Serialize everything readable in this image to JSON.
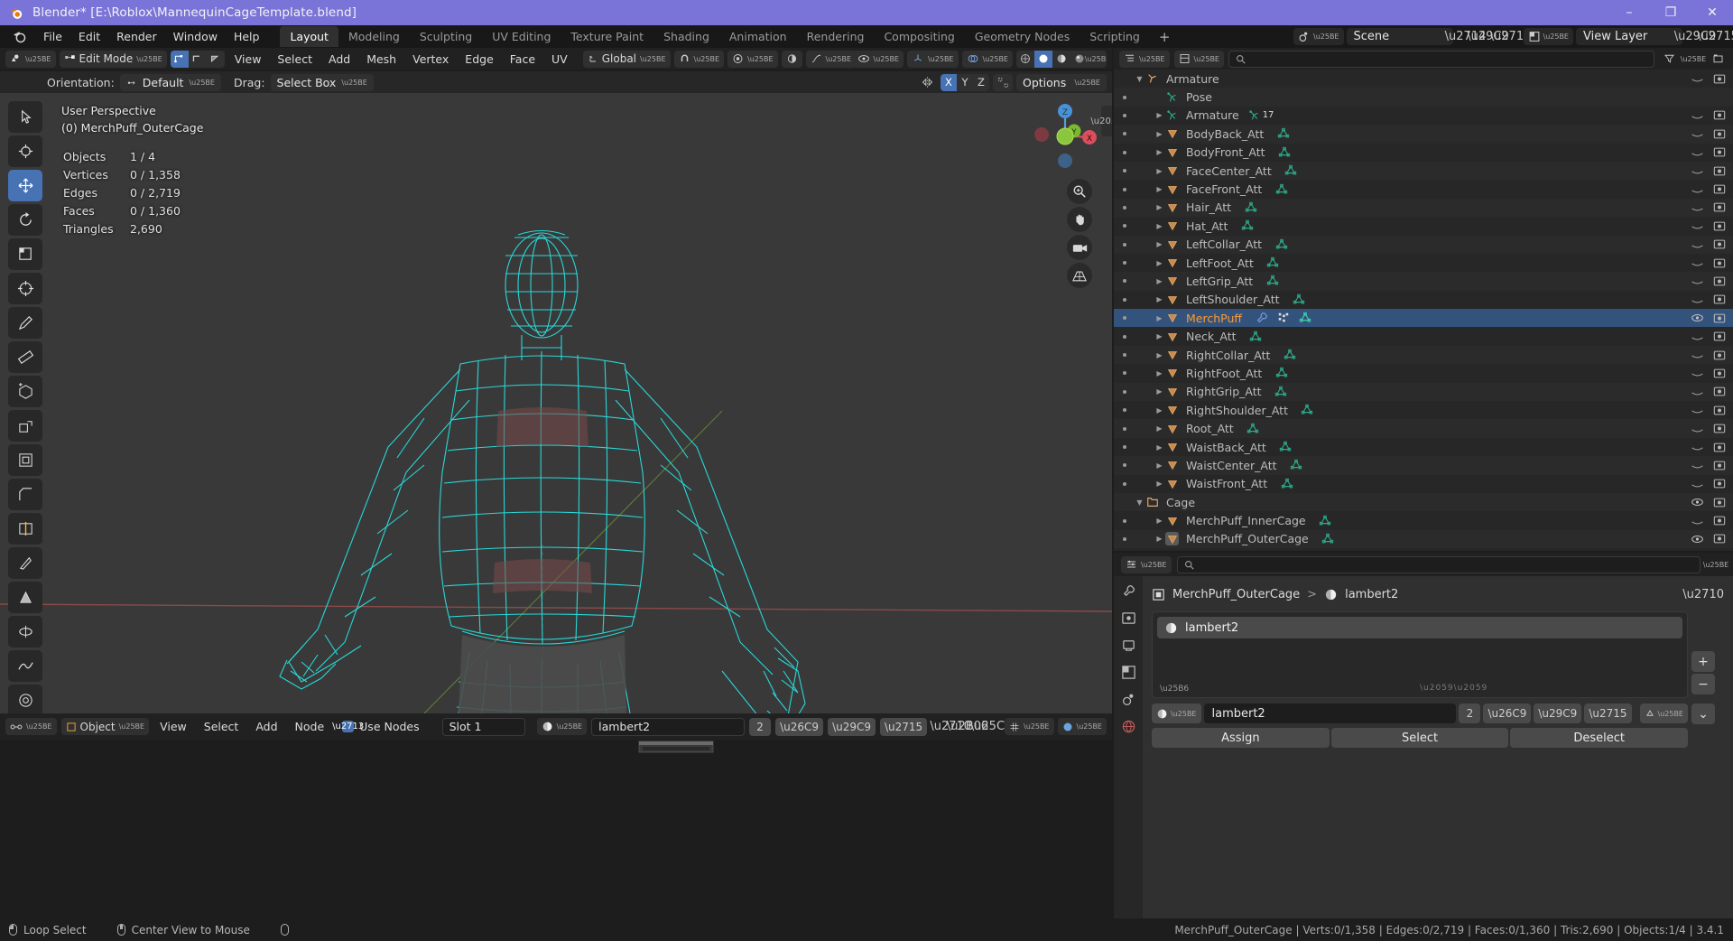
{
  "window": {
    "title": "Blender* [E:\\Roblox\\MannequinCageTemplate.blend]",
    "minimize": "–",
    "maximize": "❐",
    "close": "✕"
  },
  "topbar": {
    "menus": [
      "File",
      "Edit",
      "Render",
      "Window",
      "Help"
    ],
    "workspaces": [
      "Layout",
      "Modeling",
      "Sculpting",
      "UV Editing",
      "Texture Paint",
      "Shading",
      "Animation",
      "Rendering",
      "Compositing",
      "Geometry Nodes",
      "Scripting"
    ],
    "active_workspace": "Layout",
    "add_workspace": "+",
    "scene_name": "Scene",
    "view_layer_name": "View Layer"
  },
  "viewport_header": {
    "mode": "Edit Mode",
    "menus": [
      "View",
      "Select",
      "Add",
      "Mesh",
      "Vertex",
      "Edge",
      "Face",
      "UV"
    ],
    "transform_orientation": "Global"
  },
  "tool_settings": {
    "orientation_label": "Orientation:",
    "orientation_value": "Default",
    "drag_label": "Drag:",
    "drag_value": "Select Box",
    "axes": [
      "X",
      "Y",
      "Z"
    ],
    "active_axis": "X",
    "options_label": "Options"
  },
  "viewport": {
    "perspective": "User Perspective",
    "active_object": "(0) MerchPuff_OuterCage",
    "stats": [
      {
        "label": "Objects",
        "value": "1 / 4"
      },
      {
        "label": "Vertices",
        "value": "0 / 1,358"
      },
      {
        "label": "Edges",
        "value": "0 / 2,719"
      },
      {
        "label": "Faces",
        "value": "0 / 1,360"
      },
      {
        "label": "Triangles",
        "value": "2,690"
      }
    ],
    "gizmo_axes": {
      "x": "X",
      "y": "Y",
      "z": "Z"
    }
  },
  "node_editor": {
    "object_label": "Object",
    "menus": [
      "View",
      "Select",
      "Add",
      "Node"
    ],
    "use_nodes_label": "Use Nodes",
    "use_nodes_checked": true,
    "slot_label": "Slot 1",
    "material_name": "lambert2",
    "material_users": "2"
  },
  "outliner": {
    "search_placeholder": "",
    "rows": [
      {
        "name": "Armature",
        "indent": 0,
        "type": "armature-object",
        "expand": "down",
        "badge": ""
      },
      {
        "name": "Pose",
        "indent": 1,
        "type": "pose",
        "expand": ""
      },
      {
        "name": "Armature",
        "indent": 1,
        "type": "armature-data",
        "expand": "right",
        "badge": "17"
      },
      {
        "name": "BodyBack_Att",
        "indent": 1,
        "type": "mesh",
        "expand": "right"
      },
      {
        "name": "BodyFront_Att",
        "indent": 1,
        "type": "mesh",
        "expand": "right"
      },
      {
        "name": "FaceCenter_Att",
        "indent": 1,
        "type": "mesh",
        "expand": "right"
      },
      {
        "name": "FaceFront_Att",
        "indent": 1,
        "type": "mesh",
        "expand": "right"
      },
      {
        "name": "Hair_Att",
        "indent": 1,
        "type": "mesh",
        "expand": "right"
      },
      {
        "name": "Hat_Att",
        "indent": 1,
        "type": "mesh",
        "expand": "right"
      },
      {
        "name": "LeftCollar_Att",
        "indent": 1,
        "type": "mesh",
        "expand": "right"
      },
      {
        "name": "LeftFoot_Att",
        "indent": 1,
        "type": "mesh",
        "expand": "right"
      },
      {
        "name": "LeftGrip_Att",
        "indent": 1,
        "type": "mesh",
        "expand": "right"
      },
      {
        "name": "LeftShoulder_Att",
        "indent": 1,
        "type": "mesh",
        "expand": "right"
      },
      {
        "name": "MerchPuff",
        "indent": 1,
        "type": "mesh",
        "expand": "right",
        "selected": true
      },
      {
        "name": "Neck_Att",
        "indent": 1,
        "type": "mesh",
        "expand": "right"
      },
      {
        "name": "RightCollar_Att",
        "indent": 1,
        "type": "mesh",
        "expand": "right"
      },
      {
        "name": "RightFoot_Att",
        "indent": 1,
        "type": "mesh",
        "expand": "right"
      },
      {
        "name": "RightGrip_Att",
        "indent": 1,
        "type": "mesh",
        "expand": "right"
      },
      {
        "name": "RightShoulder_Att",
        "indent": 1,
        "type": "mesh",
        "expand": "right"
      },
      {
        "name": "Root_Att",
        "indent": 1,
        "type": "mesh",
        "expand": "right"
      },
      {
        "name": "WaistBack_Att",
        "indent": 1,
        "type": "mesh",
        "expand": "right"
      },
      {
        "name": "WaistCenter_Att",
        "indent": 1,
        "type": "mesh",
        "expand": "right"
      },
      {
        "name": "WaistFront_Att",
        "indent": 1,
        "type": "mesh",
        "expand": "right"
      },
      {
        "name": "Cage",
        "indent": 0,
        "type": "collection",
        "expand": "down"
      },
      {
        "name": "MerchPuff_InnerCage",
        "indent": 1,
        "type": "mesh",
        "expand": "right"
      },
      {
        "name": "MerchPuff_OuterCage",
        "indent": 1,
        "type": "mesh-active",
        "expand": "right"
      }
    ]
  },
  "properties": {
    "search_placeholder": "",
    "breadcrumb_object": "MerchPuff_OuterCage",
    "breadcrumb_sep": ">",
    "breadcrumb_material": "lambert2",
    "slot_material": "lambert2",
    "material_field_name": "lambert2",
    "material_users": "2",
    "buttons": {
      "assign": "Assign",
      "select": "Select",
      "deselect": "Deselect"
    },
    "add_slot": "+",
    "remove_slot": "−",
    "slot_menu": "⌄"
  },
  "statusbar": {
    "items": [
      {
        "mouse": "left",
        "label": "Loop Select"
      },
      {
        "mouse": "middle",
        "label": "Center View to Mouse"
      },
      {
        "mouse": "right",
        "label": ""
      }
    ],
    "info": "MerchPuff_OuterCage | Verts:0/1,358 | Edges:0/2,719 | Faces:0/1,360 | Tris:2,690 | Objects:1/4 | 3.4.1"
  },
  "colors": {
    "title_bar": "#7a74d8",
    "accent_blue": "#4772b3",
    "select_orange": "#ff9a2e",
    "wireframe_cyan": "#33e6e6",
    "mesh_green": "#2ea88a"
  }
}
